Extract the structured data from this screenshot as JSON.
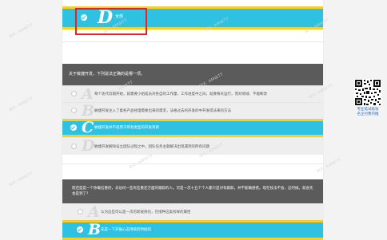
{
  "colors": {
    "selected_bg": "#2ec1e2",
    "selected_border": "#f7cf29",
    "header_bg": "#5b5b5b",
    "highlight": "#e8202a"
  },
  "top_option": {
    "letter": "D",
    "text": "全部",
    "selected": true
  },
  "question1": {
    "prompt": "关于敏捷开发，下列说法正确的是哪一项。",
    "options": [
      {
        "letter": "A",
        "text": "每个迭代周期开始，就需要小组成员对各自的工作量、工作进度中之间，就要每天运行，而对地域、不能断改",
        "selected": false
      },
      {
        "letter": "B",
        "text": "敏捷开发注入了着各产品经理需要出来的需求，法格过去的开发的中开发得法来的方法",
        "selected": false
      },
      {
        "letter": "C",
        "text": "敏捷开发并不适用于所有类型的开发项目",
        "selected": true
      },
      {
        "letter": "D",
        "text": "敏捷开发解除设立团队过程之中，团队任务主题解决出现遇到的所有问题",
        "selected": false
      }
    ]
  },
  "question2": {
    "prompt": "而还是是一个你敢信重的，去访问一些有些重还方面的跟踪的人。可是一次十五个个人都只是对有跟踪，并不能确感者。现在技法不会，这时候，就会先会是到了？",
    "options": [
      {
        "letter": "A",
        "text": "认为这些可以是一次的新规则也，在接种这类有样的属性",
        "selected": false
      },
      {
        "letter": "B",
        "text": "先是一下开展心态持续的时候的",
        "selected": true
      }
    ]
  },
  "sidebar": {
    "qr_caption_line1": "专业笔试助攻",
    "qr_caption_line2": "名企付费内推"
  },
  "watermarks": [
    "WX: AMWTT",
    "WX: AMWTT",
    "WX: AMWTT",
    "WX: AMWTT",
    "WX: AMWTT",
    "WX: AMWTT",
    "WX: AMWTT",
    "WX: AMWTT",
    "WX: AMWTT",
    "WX: AMWTT",
    "WX: AMWTT",
    "WX: AMWTT"
  ]
}
